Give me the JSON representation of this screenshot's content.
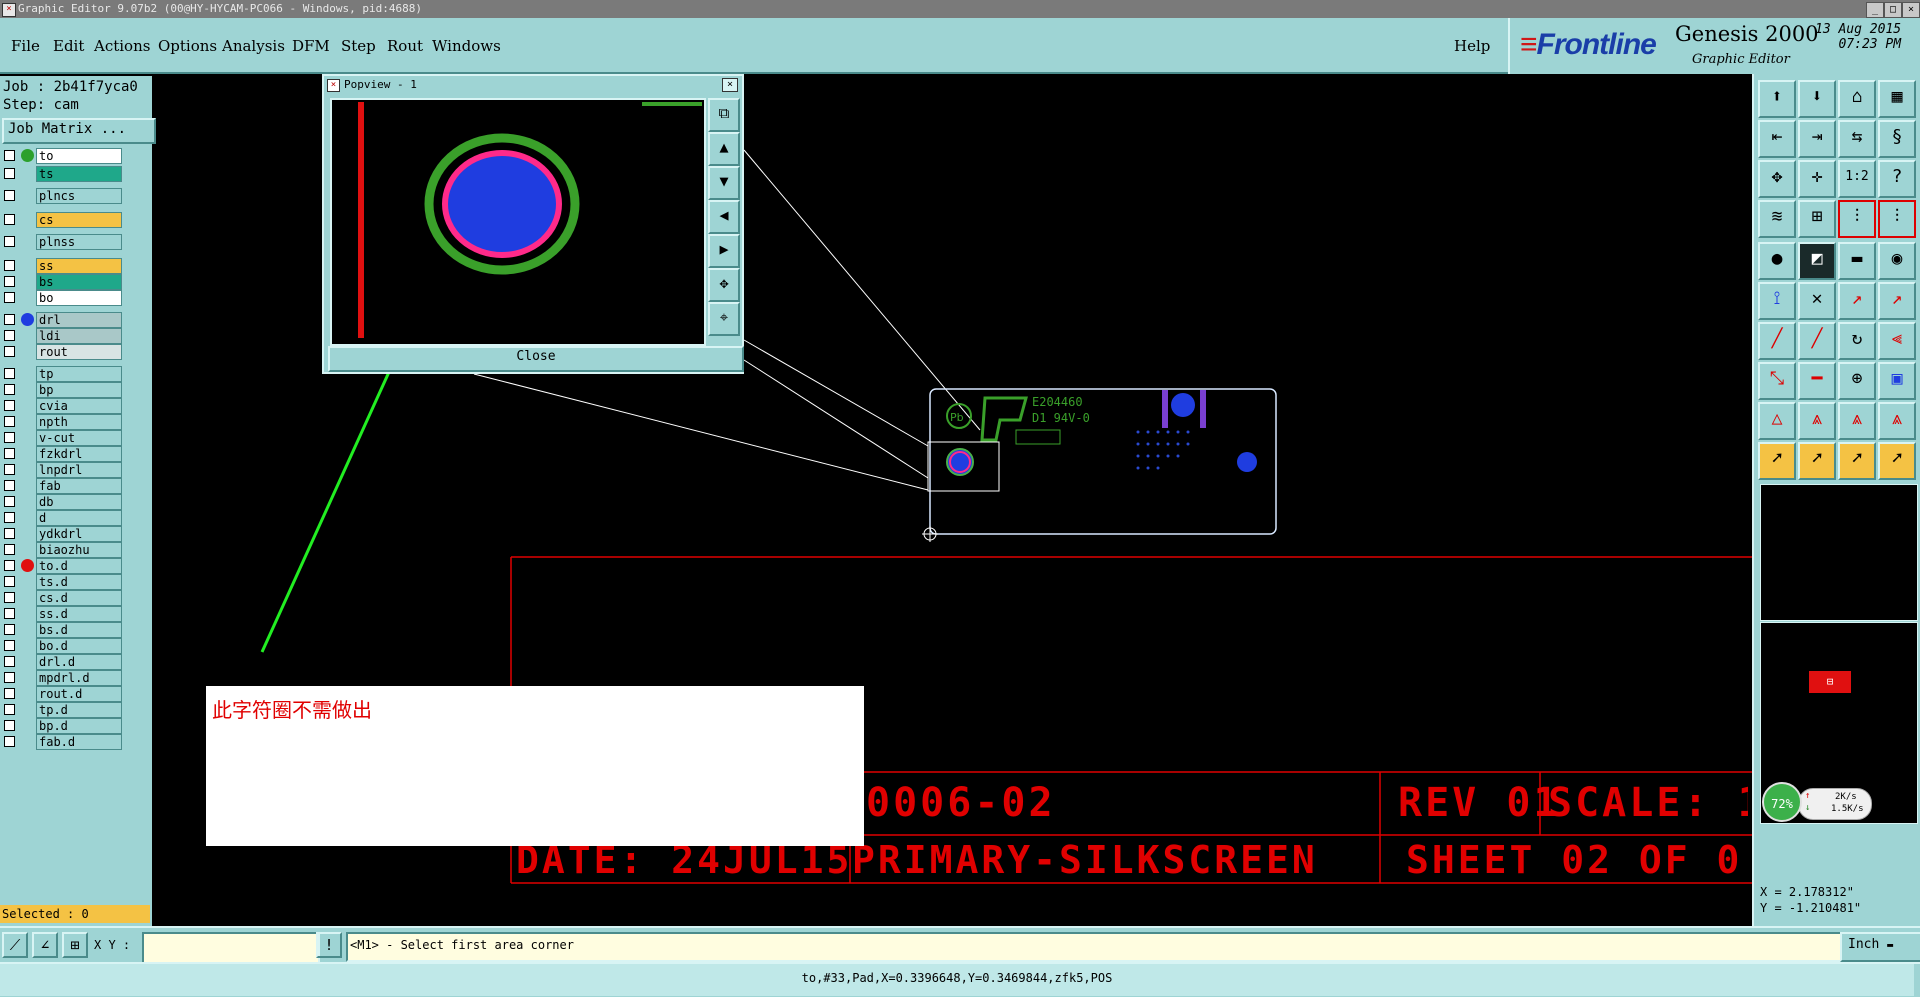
{
  "window": {
    "title": "Graphic Editor 9.07b2 (00@HY-HYCAM-PC066 - Windows, pid:4688)",
    "icon": "x-app-icon"
  },
  "menu": {
    "items": [
      "File",
      "Edit",
      "Actions",
      "Options",
      "Analysis",
      "DFM",
      "Step",
      "Rout",
      "Windows"
    ],
    "help": "Help"
  },
  "brand": {
    "logo": "Frontline",
    "product": "Genesis 2000",
    "subtitle": "Graphic Editor",
    "date": "13 Aug 2015",
    "time": "07:23 PM"
  },
  "job": {
    "job_line": "Job : 2b41f7yca0",
    "step_line": "Step: cam",
    "matrix_button": "Job Matrix ..."
  },
  "layers": [
    {
      "name": "to",
      "bg": "#ffffff",
      "dot": "#2ca02c"
    },
    {
      "name": "ts",
      "bg": "#1fa88a",
      "dot": ""
    },
    {
      "name": "plncs",
      "bg": "#9ed4d4",
      "dot": ""
    },
    {
      "name": "cs",
      "bg": "#f4c244",
      "dot": ""
    },
    {
      "name": "plnss",
      "bg": "#9ed4d4",
      "dot": ""
    },
    {
      "name": "ss",
      "bg": "#f4c244",
      "dot": ""
    },
    {
      "name": "bs",
      "bg": "#1fa88a",
      "dot": ""
    },
    {
      "name": "bo",
      "bg": "#ffffff",
      "dot": ""
    },
    {
      "name": "drl",
      "bg": "#a9c8c8",
      "dot": "#1f3de0"
    },
    {
      "name": "ldi",
      "bg": "#a9c8c8",
      "dot": ""
    },
    {
      "name": "rout",
      "bg": "#d8e4e4",
      "dot": ""
    },
    {
      "name": "tp",
      "bg": "#9ed4d4",
      "dot": ""
    },
    {
      "name": "bp",
      "bg": "#9ed4d4",
      "dot": ""
    },
    {
      "name": "cvia",
      "bg": "#9ed4d4",
      "dot": ""
    },
    {
      "name": "npth",
      "bg": "#9ed4d4",
      "dot": ""
    },
    {
      "name": "v-cut",
      "bg": "#9ed4d4",
      "dot": ""
    },
    {
      "name": "fzkdrl",
      "bg": "#9ed4d4",
      "dot": ""
    },
    {
      "name": "lnpdrl",
      "bg": "#9ed4d4",
      "dot": ""
    },
    {
      "name": "fab",
      "bg": "#9ed4d4",
      "dot": ""
    },
    {
      "name": "db",
      "bg": "#9ed4d4",
      "dot": ""
    },
    {
      "name": "d",
      "bg": "#9ed4d4",
      "dot": ""
    },
    {
      "name": "ydkdrl",
      "bg": "#9ed4d4",
      "dot": ""
    },
    {
      "name": "biaozhu",
      "bg": "#9ed4d4",
      "dot": ""
    },
    {
      "name": "to.d",
      "bg": "#9ed4d4",
      "dot": "#e01010"
    },
    {
      "name": "ts.d",
      "bg": "#9ed4d4",
      "dot": ""
    },
    {
      "name": "cs.d",
      "bg": "#9ed4d4",
      "dot": ""
    },
    {
      "name": "ss.d",
      "bg": "#9ed4d4",
      "dot": ""
    },
    {
      "name": "bs.d",
      "bg": "#9ed4d4",
      "dot": ""
    },
    {
      "name": "bo.d",
      "bg": "#9ed4d4",
      "dot": ""
    },
    {
      "name": "drl.d",
      "bg": "#9ed4d4",
      "dot": ""
    },
    {
      "name": "mpdrl.d",
      "bg": "#9ed4d4",
      "dot": ""
    },
    {
      "name": "rout.d",
      "bg": "#9ed4d4",
      "dot": ""
    },
    {
      "name": "tp.d",
      "bg": "#9ed4d4",
      "dot": ""
    },
    {
      "name": "bp.d",
      "bg": "#9ed4d4",
      "dot": ""
    },
    {
      "name": "fab.d",
      "bg": "#9ed4d4",
      "dot": ""
    }
  ],
  "selected_count": "Selected : 0",
  "popview": {
    "title": "Popview - 1",
    "close_label": "Close"
  },
  "board": {
    "ul_line1": "E204460",
    "ul_line2": "D1 94V-0"
  },
  "annotation": {
    "text": "此字符圈不需做出"
  },
  "titleblock": {
    "part_number": "0006-02",
    "rev": "REV 01",
    "scale": "SCALE: 1",
    "date": "DATE: 24JUL15",
    "layer_name": "PRIMARY-SILKSCREEN",
    "sheet": "SHEET 02 OF 0"
  },
  "network": {
    "percent": "72%",
    "up": "2K/s",
    "down": "1.5K/s"
  },
  "coords": {
    "x": "X = 2.178312\"",
    "y": "Y = -1.210481\""
  },
  "command": {
    "xy_label": "X Y :",
    "xy_value": "",
    "prompt": "<M1> - Select first area corner",
    "units": "Inch"
  },
  "status": "to,#33,Pad,X=0.3396648,Y=0.3469844,zfk5,POS",
  "colors": {
    "panel": "#9ed4d4",
    "canvas": "#000000",
    "profile": "#d8e8ff",
    "title_block": "#e00000",
    "arrow": "#22ee22"
  }
}
